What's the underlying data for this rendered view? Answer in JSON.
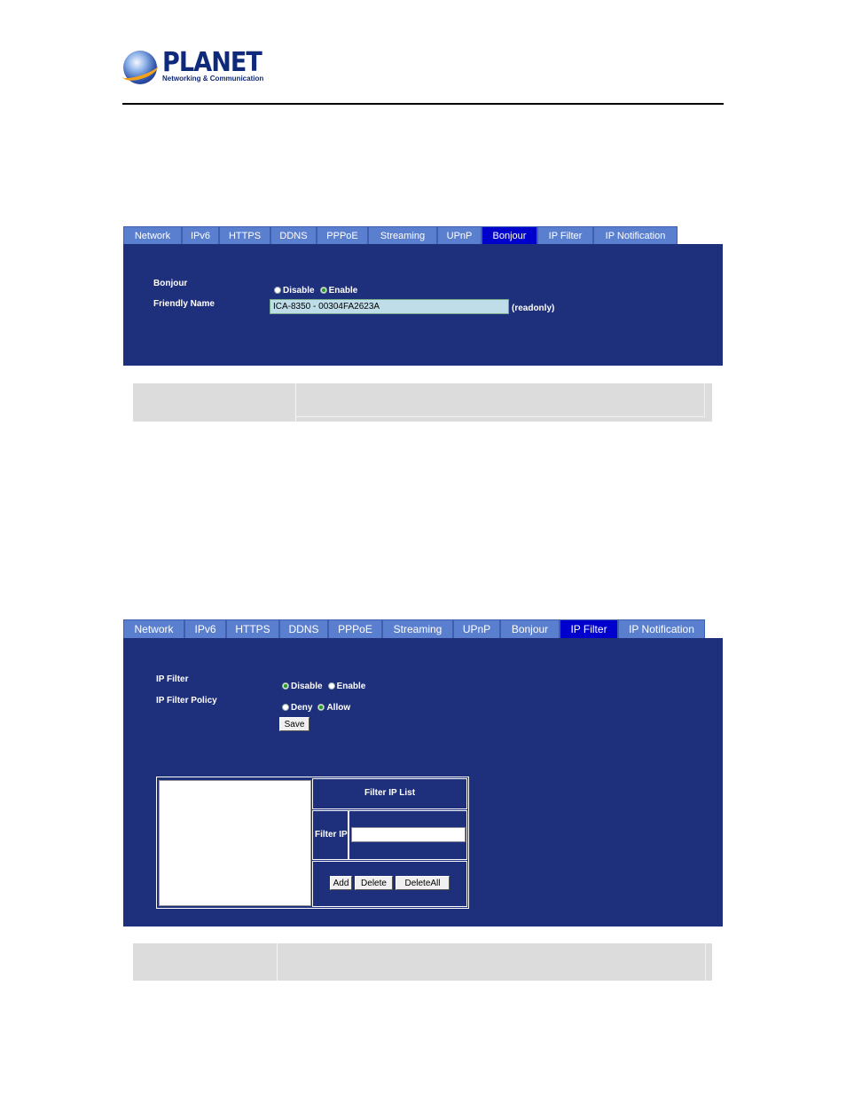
{
  "logo": {
    "brand": "PLANET",
    "tagline": "Networking & Communication"
  },
  "tabs": [
    "Network",
    "IPv6",
    "HTTPS",
    "DDNS",
    "PPPoE",
    "Streaming",
    "UPnP",
    "Bonjour",
    "IP Filter",
    "IP Notification"
  ],
  "panel1": {
    "active_tab": "Bonjour",
    "bonjour_label": "Bonjour",
    "disable_label": "Disable",
    "enable_label": "Enable",
    "selected": "Enable",
    "friendly_name_label": "Friendly Name",
    "friendly_name_value": "ICA-8350 - 00304FA2623A",
    "readonly_note": "(readonly)"
  },
  "panel2": {
    "active_tab": "IP Filter",
    "ip_filter_label": "IP Filter",
    "disable_label": "Disable",
    "enable_label": "Enable",
    "ip_filter_selected": "Disable",
    "policy_label": "IP Filter Policy",
    "deny_label": "Deny",
    "allow_label": "Allow",
    "policy_selected": "Allow",
    "save_label": "Save",
    "list_title": "Filter IP List",
    "filter_ip_label": "Filter IP",
    "filter_ip_value": "",
    "add_label": "Add",
    "delete_label": "Delete",
    "delete_all_label": "DeleteAll"
  },
  "colors": {
    "panel_bg": "#1e2f7c",
    "tab_bg": "#5b7fcf",
    "tab_active": "#0000cc"
  }
}
